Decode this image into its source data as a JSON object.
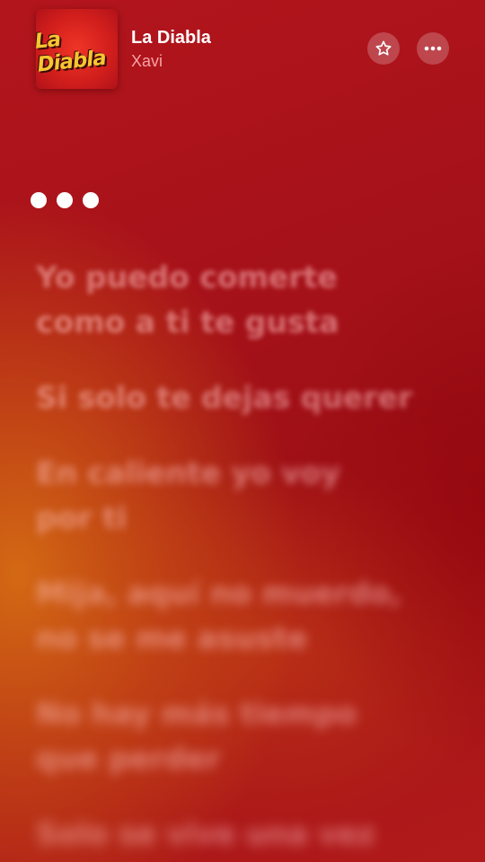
{
  "song": {
    "title": "La Diabla",
    "artist": "Xavi",
    "artwork_text": "La Diabla"
  },
  "header_buttons": {
    "favorite_icon": "star-icon",
    "more_icon": "ellipsis-icon"
  },
  "lyrics": {
    "current_indicator": "typing-dots",
    "lines": [
      "Yo puedo comerte\ncomo a ti te gusta",
      "Si solo te dejas querer",
      "En caliente yo voy\npor ti",
      "Mija, aquí no muerdo,\nno se me asuste",
      "No hay más tiempo\nque perder",
      "Solo se vive una vez"
    ]
  },
  "colors": {
    "background_red": "#b3151c",
    "background_orange": "#d66e14",
    "artist_pink": "#f5a3a6",
    "lyric_dim": "rgba(255,190,190,0.55)"
  }
}
